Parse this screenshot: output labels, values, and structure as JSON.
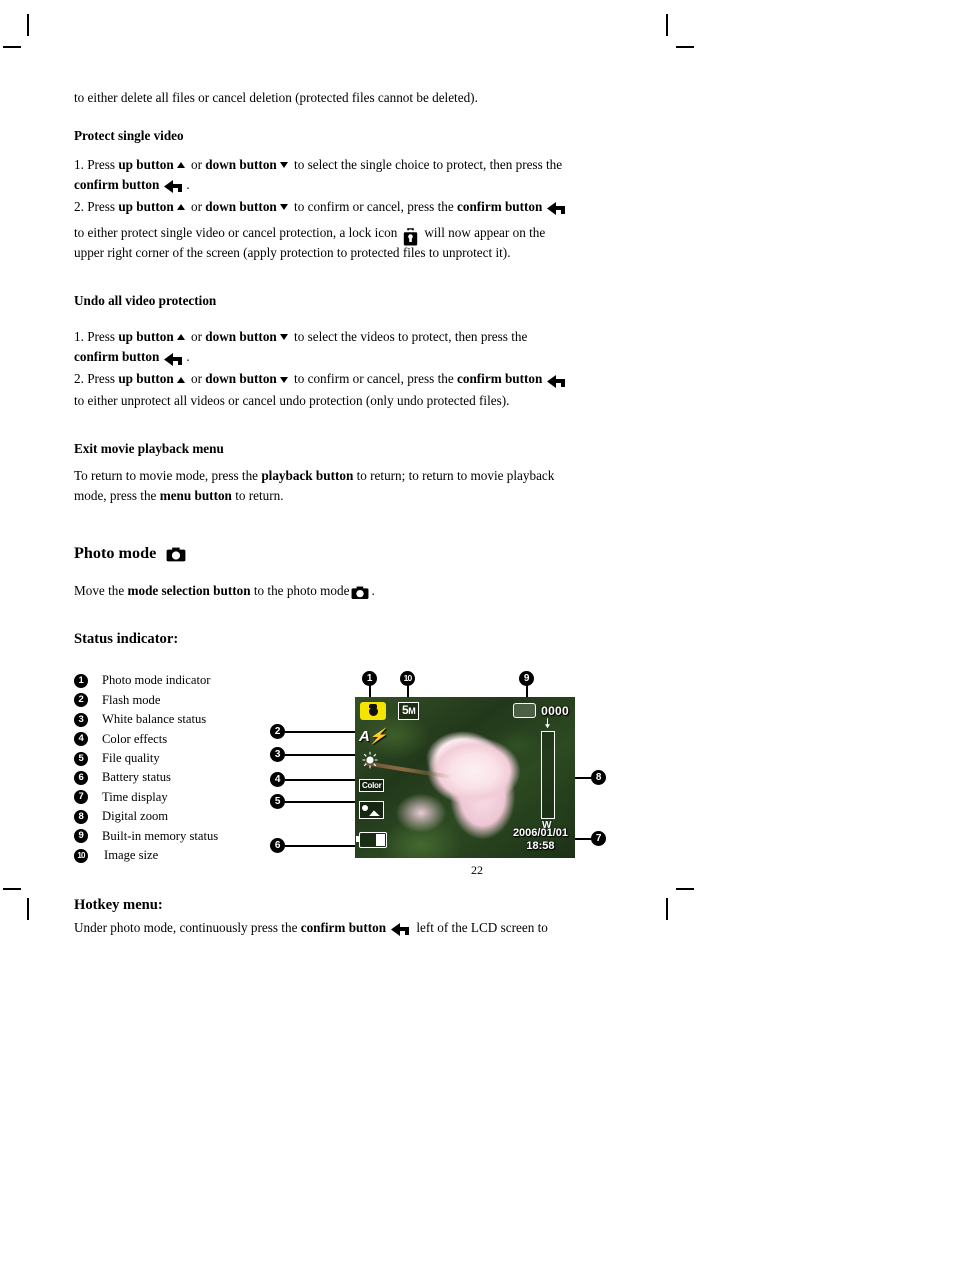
{
  "document": {
    "page_number": "22"
  },
  "intro_line": {
    "text": "to either delete all files or cancel deletion (protected files cannot be deleted)."
  },
  "protect_single_video": {
    "heading": "Protect single video",
    "step1": {
      "prefix": "1. Press ",
      "up_label": "up button",
      "or": " or ",
      "down_label": "down button",
      "middle": " to select the single choice to protect, then press the ",
      "confirm_label": "confirm button",
      "suffix": "."
    },
    "step2": {
      "prefix": "2. Press ",
      "up_label": "up button",
      "or": " or ",
      "down_label": "down button",
      "middle": " to confirm or cancel, press the ",
      "confirm_label": "confirm button"
    },
    "result_part1": "to either protect single video or cancel protection, a lock icon",
    "result_part2": "will now appear on the",
    "result_line2": "upper right corner of the screen (apply protection to protected files to unprotect it)."
  },
  "undo_all_video_protection": {
    "heading": "Undo all video protection",
    "step1": {
      "prefix": "1. Press ",
      "up_label": "up button",
      "or": " or ",
      "down_label": "down button",
      "middle": " to select the videos to protect, then press the ",
      "confirm_label": "confirm button",
      "suffix": "."
    },
    "step2": {
      "prefix": "2. Press ",
      "up_label": "up button",
      "or": " or ",
      "down_label": "down button",
      "middle": " to confirm or cancel, press the ",
      "confirm_label": "confirm button"
    },
    "result_line": "to either unprotect all videos or cancel undo protection (only undo protected files)."
  },
  "exit_movie_playback_menu": {
    "heading": "Exit movie playback menu",
    "body_part1": "To return to movie mode, press the ",
    "playback_label": "playback button",
    "body_part2": " to return; to return to movie playback",
    "body_line2_prefix": "mode, press the ",
    "menu_label": "menu button",
    "body_line2_suffix": " to return."
  },
  "photo_mode": {
    "heading": "Photo mode",
    "body_prefix": "Move the ",
    "mode_selection_label": "mode selection button",
    "body_middle": " to the photo mode",
    "body_suffix": "."
  },
  "status_indicator": {
    "heading": "Status indicator:",
    "items": [
      {
        "number": "1",
        "label": "Photo mode indicator"
      },
      {
        "number": "2",
        "label": "Flash mode"
      },
      {
        "number": "3",
        "label": "White balance status"
      },
      {
        "number": "4",
        "label": "Color effects"
      },
      {
        "number": "5",
        "label": "File quality"
      },
      {
        "number": "6",
        "label": "Battery status"
      },
      {
        "number": "7",
        "label": "Time display"
      },
      {
        "number": "8",
        "label": "Digital zoom"
      },
      {
        "number": "9",
        "label": "Built-in memory status"
      },
      {
        "number": "10",
        "label": "Image size"
      }
    ],
    "callouts": {
      "c1": "1",
      "c2": "2",
      "c3": "3",
      "c4": "4",
      "c5": "5",
      "c6": "6",
      "c7": "7",
      "c8": "8",
      "c9": "9",
      "c10": "10"
    },
    "lcd_osd": {
      "image_size": "5",
      "image_size_unit": "M",
      "memory_count": "0000",
      "flash_mode": "A",
      "color_effect": "Color",
      "date": "2006/01/01",
      "time": "18:58",
      "zoom_wide_label": "W"
    },
    "colors": {
      "mode_badge": "#f5e400",
      "osd_text": "#ffffff",
      "callout_bg": "#000000"
    }
  },
  "hotkey_menu": {
    "heading": "Hotkey menu:",
    "body_prefix": "Under photo mode, continuously press the ",
    "confirm_label": "confirm button",
    "body_suffix": " left of the LCD screen to"
  }
}
